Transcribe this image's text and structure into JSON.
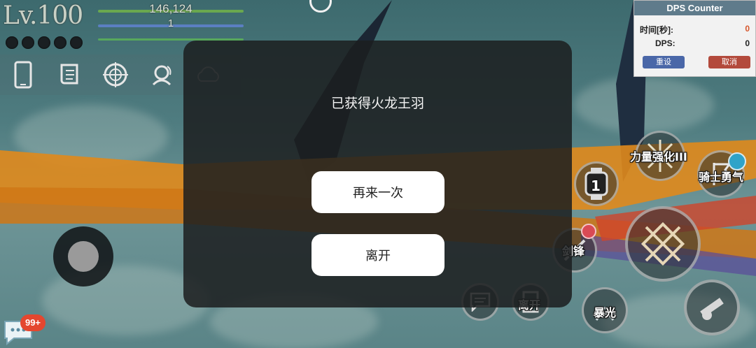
{
  "hud": {
    "level": "Lv.100",
    "hp_value": "146,124",
    "mp_value": "1",
    "colors": {
      "hp_bar": "#6aa84f",
      "mp_bar": "#5b7fc2",
      "exp_bar": "#58a85c"
    }
  },
  "toolbar_icons": [
    "phone-icon",
    "scroll-icon",
    "target-icon",
    "support-headset-icon",
    "cloud-icon"
  ],
  "dps_counter": {
    "title": "DPS Counter",
    "time_label": "时间[秒]:",
    "time_value": "0",
    "dps_label": "DPS:",
    "dps_value": "0",
    "reset_label": "重设",
    "cancel_label": "取消",
    "colors": {
      "reset": "#4a67a8",
      "cancel": "#b34a3c",
      "time_value": "#d6562b"
    }
  },
  "dialog": {
    "title": "已获得火龙王羽",
    "retry_label": "再来一次",
    "leave_label": "离开"
  },
  "chat": {
    "badge": "99+"
  },
  "skills": {
    "power_boost": "力量强化III",
    "knight_courage": "骑士勇气",
    "watch_count": "1",
    "sword_edge": "剑锋",
    "leave": "离开",
    "burst_light": "暴光"
  }
}
